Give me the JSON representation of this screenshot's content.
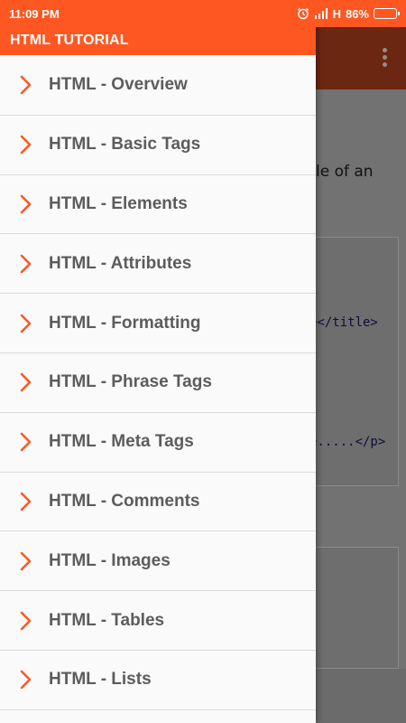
{
  "status_bar": {
    "time": "11:09 PM",
    "network": "H",
    "battery": "86%",
    "battery_level": 0.86,
    "icons": [
      "alarm-icon",
      "signal-icon",
      "battery-icon"
    ]
  },
  "drawer": {
    "title": "HTML TUTORIAL",
    "accent_color": "#ff5722",
    "item_icon": "chevron-right-icon",
    "items": [
      {
        "label": "HTML - Overview"
      },
      {
        "label": "HTML - Basic Tags"
      },
      {
        "label": "HTML - Elements"
      },
      {
        "label": "HTML - Attributes"
      },
      {
        "label": "HTML - Formatting"
      },
      {
        "label": "HTML - Phrase Tags"
      },
      {
        "label": "HTML - Meta Tags"
      },
      {
        "label": "HTML - Comments"
      },
      {
        "label": "HTML - Images"
      },
      {
        "label": "HTML - Tables"
      },
      {
        "label": "HTML - Lists"
      }
    ]
  },
  "background_page": {
    "toolbar_icon": "more-vert-icon",
    "paragraph_fragment": "le of an",
    "code_fragments": [
      "e</title>",
      "e.....</p>"
    ]
  }
}
